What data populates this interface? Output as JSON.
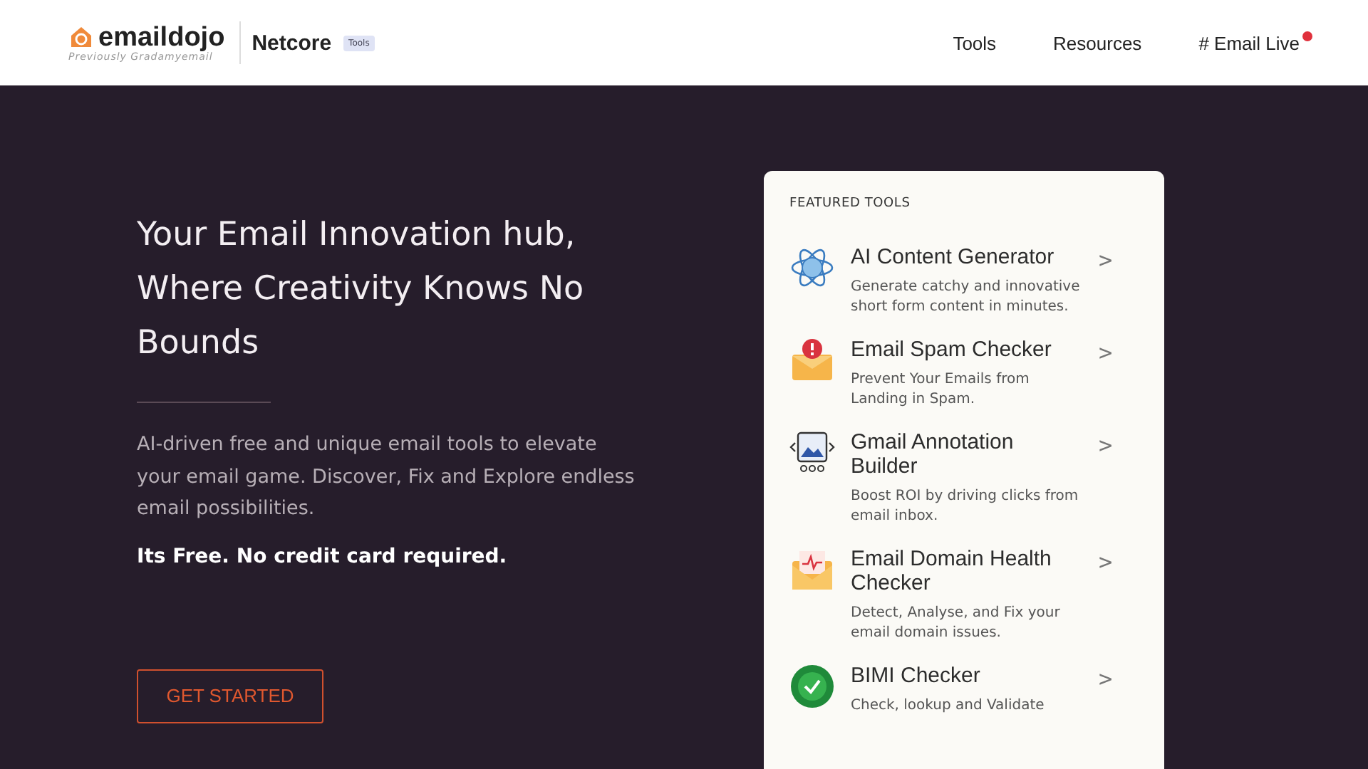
{
  "header": {
    "logo": {
      "name": "emaildojo",
      "tagline": "Previously Gradamyemail"
    },
    "partner": {
      "name": "Netcore",
      "badge": "Tools"
    },
    "nav": [
      {
        "label": "Tools",
        "live": false
      },
      {
        "label": "Resources",
        "live": false
      },
      {
        "label": "# Email Live",
        "live": true
      }
    ]
  },
  "hero": {
    "title": "Your Email Innovation hub, Where Creativity Knows No Bounds",
    "description": "AI-driven free and unique email tools to elevate your email game. Discover, Fix and Explore endless email possibilities.",
    "note": "Its Free. No credit card required.",
    "cta": "GET STARTED"
  },
  "featured": {
    "heading": "FEATURED TOOLS",
    "tools": [
      {
        "kind": "ai",
        "title": "AI Content Generator",
        "description": "Generate catchy and innovative short form content in minutes.",
        "arrow": ">"
      },
      {
        "kind": "spam",
        "title": "Email Spam Checker",
        "description": "Prevent Your Emails from Landing in Spam.",
        "arrow": ">"
      },
      {
        "kind": "annotation",
        "title": "Gmail Annotation Builder",
        "description": "Boost ROI by driving clicks from email inbox.",
        "arrow": ">"
      },
      {
        "kind": "health",
        "title": "Email Domain Health Checker",
        "description": "Detect, Analyse, and Fix your email domain issues.",
        "arrow": ">"
      },
      {
        "kind": "bimi",
        "title": "BIMI Checker",
        "description": "Check, lookup and Validate",
        "arrow": ">"
      }
    ]
  }
}
